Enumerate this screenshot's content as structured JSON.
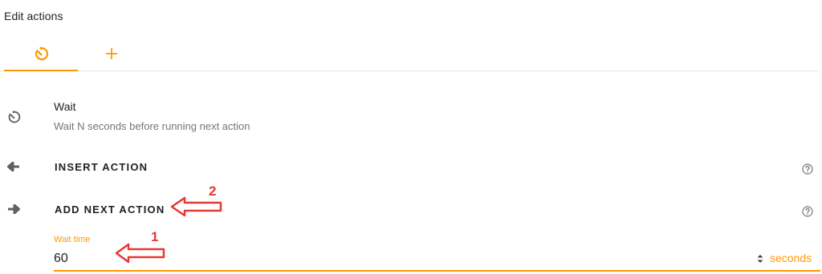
{
  "header": {
    "title": "Edit actions"
  },
  "tabs": [
    {
      "icon": "timer-icon",
      "active": true
    },
    {
      "icon": "plus-icon",
      "active": false
    }
  ],
  "action": {
    "icon": "timer-icon",
    "title": "Wait",
    "description": "Wait N seconds before running next action"
  },
  "insert_action": {
    "icon": "arrow-left-icon",
    "label": "INSERT ACTION"
  },
  "add_next_action": {
    "icon": "arrow-right-icon",
    "label": "ADD NEXT ACTION"
  },
  "wait_time": {
    "label": "Wait time",
    "value": "60",
    "suffix": "seconds"
  },
  "annotations": [
    {
      "number": "1",
      "target": "wait-time-input"
    },
    {
      "number": "2",
      "target": "add-next-action-button"
    }
  ],
  "colors": {
    "accent": "#ff9800",
    "annotation": "#e53935",
    "text": "#212121",
    "muted": "#757575"
  }
}
